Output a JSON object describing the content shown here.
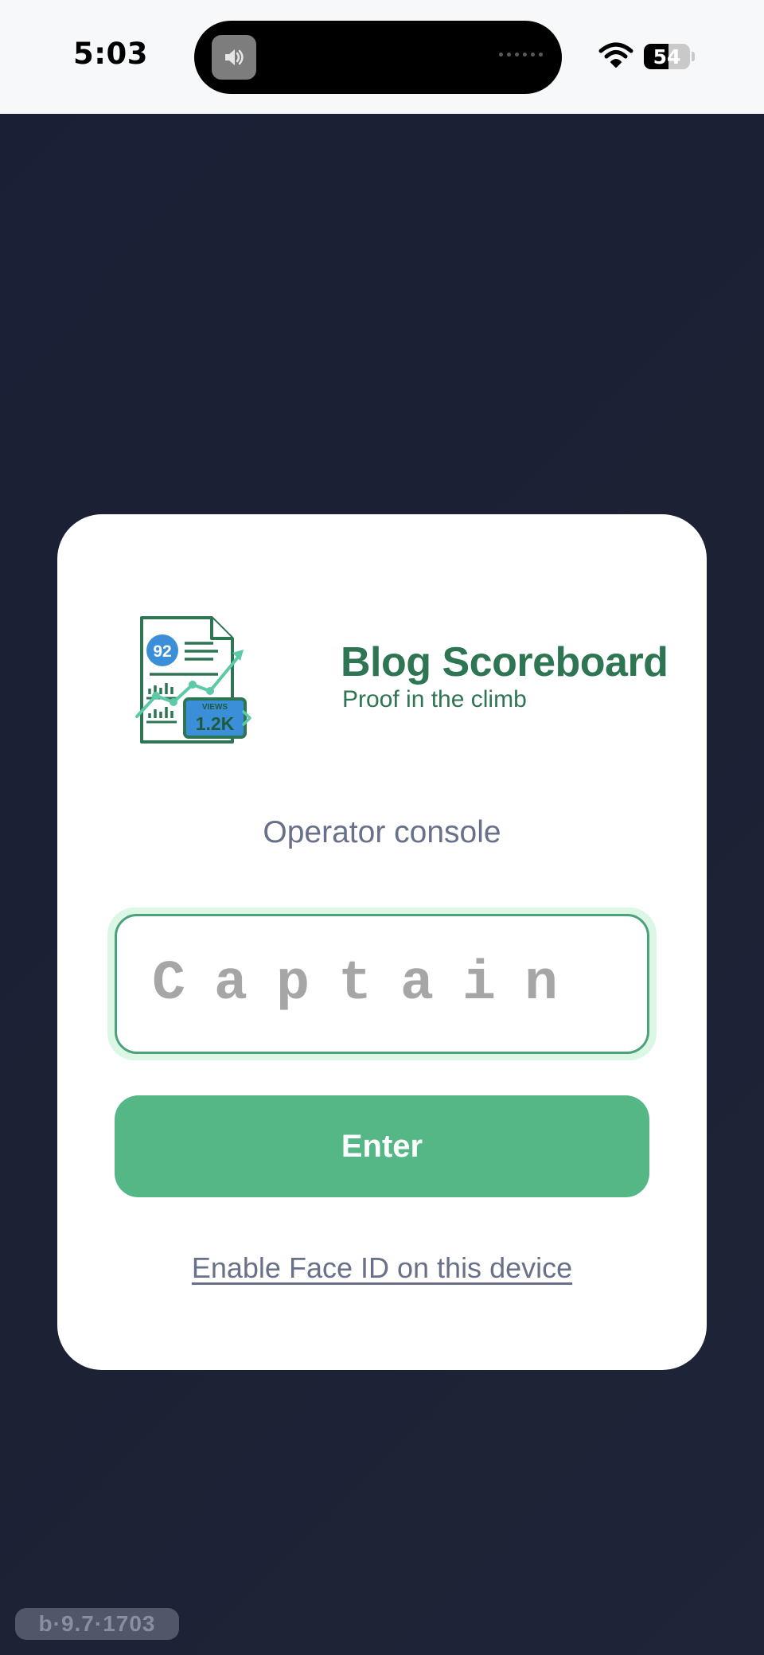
{
  "status_bar": {
    "time": "5:03",
    "battery_level": "54",
    "battery_fraction": 0.54
  },
  "brand": {
    "name": "Blog Scoreboard",
    "tagline": "Proof in the climb",
    "logo_icon": "report-chart-icon",
    "logo_score": "92",
    "logo_views_label": "VIEWS",
    "logo_views_value": "1.2K"
  },
  "login": {
    "title": "Operator console",
    "name_input": {
      "value": "",
      "placeholder": "Captain"
    },
    "submit_label": "Enter",
    "faceid_link": "Enable Face ID on this device"
  },
  "version": "b·9.7·1703",
  "colors": {
    "background": "#1c2134",
    "card": "#ffffff",
    "brand_green": "#2d7553",
    "button_green": "#55b786",
    "muted_text": "#697089",
    "input_border": "#4aa27a",
    "input_glow": "#ddf7e7",
    "logo_blue": "#3b8fd9"
  }
}
